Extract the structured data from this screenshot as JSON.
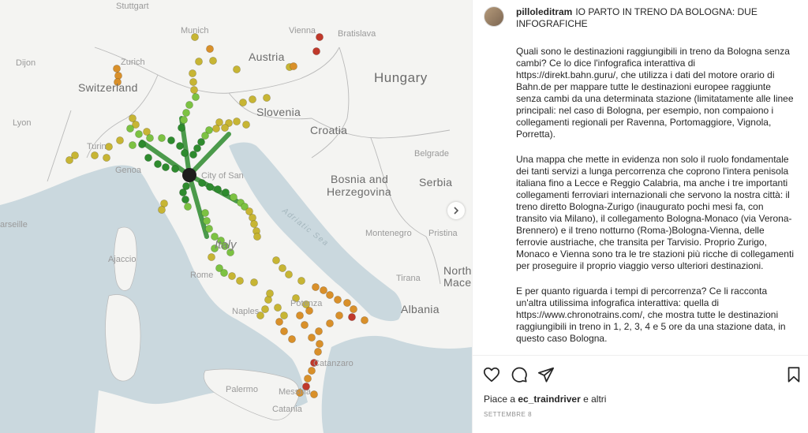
{
  "map": {
    "labels": {
      "stuttgart": "Stuttgart",
      "munich": "Munich",
      "vienna": "Vienna",
      "bratislava": "Bratislava",
      "dijon": "Dijon",
      "zurich": "Zurich",
      "austria": "Austria",
      "hungary": "Hungary",
      "switzerland": "Switzerland",
      "slovenia": "Slovenia",
      "lyon": "Lyon",
      "croatia": "Croatia",
      "turin": "Turin",
      "genoa": "Genoa",
      "city_of_san": "City of San",
      "belgrade": "Belgrade",
      "bosnia": "Bosnia and",
      "herzegovina": "Herzegovina",
      "serbia": "Serbia",
      "marseille": "arseille",
      "montenegro": "Montenegro",
      "pristina": "Pristina",
      "ajaccio": "Ajaccio",
      "italy": "Italy",
      "adriatic": "Adriatic Sea",
      "rome": "Rome",
      "tirana": "Tirana",
      "north": "North",
      "macedonia": "Macedo",
      "potenza": "Potenza",
      "naples": "Naples",
      "albania": "Albania",
      "catanzaro": "Catanzaro",
      "palermo": "Palermo",
      "messina": "Messina",
      "catania": "Catania"
    },
    "colors": {
      "land": "#f4f4f2",
      "sea": "#cad8de",
      "border": "#b9b9b9",
      "hub": "#1d1d1d",
      "near": "#2e8b2e",
      "mid": "#7cc242",
      "far": "#c7b534",
      "farther": "#d9902a",
      "farthest": "#c0392b"
    },
    "next_icon": "chevron-right-icon"
  },
  "post": {
    "username": "pilloleditram",
    "title": "IO PARTO IN TRENO DA BOLOGNA: DUE INFOGRAFICHE",
    "paragraphs": [
      "Quali sono le destinazioni raggiungibili in treno da Bologna senza cambi? Ce lo dice l'infografica interattiva di https://direkt.bahn.guru/, che utilizza i dati del motore orario di Bahn.de per mappare tutte le destinazioni europee raggiunte senza cambi da una determinata stazione (limitatamente alle linee principali: nel caso di Bologna, per esempio, non compaiono i collegamenti regionali per Ravenna, Portomaggiore, Vignola, Porretta).",
      "Una mappa che mette in evidenza non solo il ruolo fondamentale dei tanti servizi a lunga percorrenza che coprono l'intera penisola italiana fino a Lecce e Reggio Calabria, ma anche i tre importanti collegamenti ferroviari internazionali che servono la nostra città: il treno diretto Bologna-Zurigo (inaugurato pochi mesi fa, con transito via Milano), il collegamento Bologna-Monaco (via Verona-Brennero) e il treno notturno (Roma-)Bologna-Vienna, delle ferrovie austriache, che transita per Tarvisio. Proprio Zurigo, Monaco e Vienna sono tra le tre stazioni più ricche di collegamenti per proseguire il proprio viaggio verso ulteriori destinazioni.",
      "E per quanto riguarda i tempi di percorrenza? Ce li racconta un'altra utilissima infografica interattiva: quella di https://www.chronotrains.com/, che mostra tutte le destinazioni raggiungibili in treno in 1, 2, 3, 4 e 5 ore da una stazione data, in questo caso Bologna."
    ],
    "likes_prefix": "Piace a",
    "likes_user": "ec_traindriver",
    "likes_suffix": "e altri",
    "date": "SETTEMBRE 8",
    "icons": {
      "like": "heart-icon",
      "comment": "comment-icon",
      "share": "share-icon",
      "save": "bookmark-icon"
    }
  }
}
